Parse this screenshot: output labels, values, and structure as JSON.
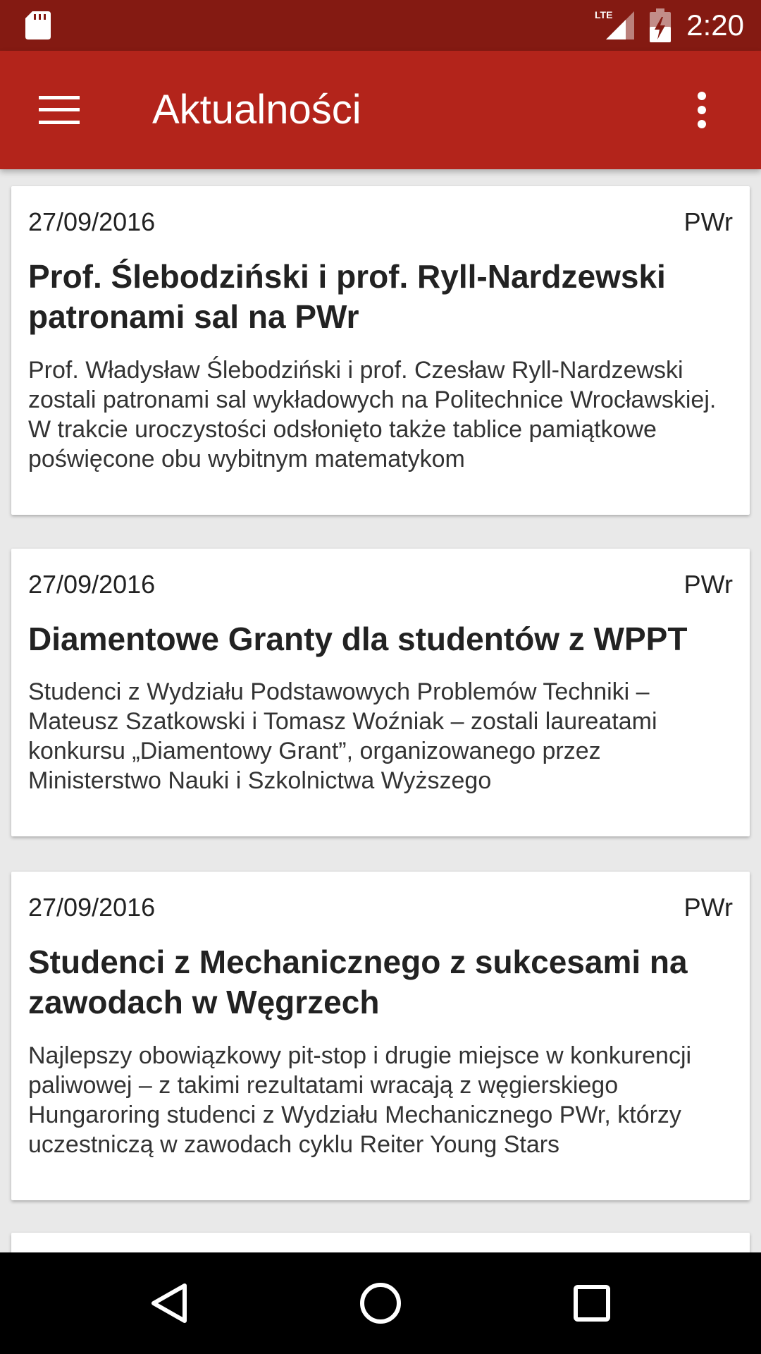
{
  "status_bar": {
    "time": "2:20",
    "network_label": "LTE",
    "icons": [
      "sd-card-icon",
      "lte-signal-icon",
      "battery-charging-icon"
    ]
  },
  "app_bar": {
    "title": "Aktualności",
    "icons": [
      "menu-icon",
      "more-vert-icon"
    ]
  },
  "articles": [
    {
      "date": "27/09/2016",
      "source": "PWr",
      "title": "Prof. Ślebodziński i prof. Ryll-Nardzewski patronami sal na PWr",
      "summary": "Prof. Władysław Ślebodziński i prof. Czesław Ryll-Nardzewski zostali patronami sal wykładowych na Politechnice Wrocławskiej. W trakcie uroczystości odsłonięto także tablice pamiątkowe poświęcone obu wybitnym matematykom"
    },
    {
      "date": "27/09/2016",
      "source": "PWr",
      "title": "Diamentowe Granty dla studentów z WPPT",
      "summary": "Studenci z Wydziału Podstawowych Problemów Techniki – Mateusz Szatkowski i Tomasz Woźniak – zostali laureatami konkursu „Diamentowy Grant”, organizowanego przez Ministerstwo Nauki i Szkolnictwa Wyższego"
    },
    {
      "date": "27/09/2016",
      "source": "PWr",
      "title": "Studenci z Mechanicznego z sukcesami na zawodach w Węgrzech",
      "summary": "Najlepszy obowiązkowy pit-stop i drugie miejsce w konkurencji paliwowej – z takimi rezultatami wracają z węgierskiego Hungaroring studenci z Wydziału Mechanicznego PWr, którzy uczestniczą w zawodach cyklu Reiter Young Stars"
    }
  ],
  "nav_bar": {
    "icons": [
      "back-icon",
      "home-icon",
      "recents-icon"
    ]
  },
  "colors": {
    "status_bar": "#841a12",
    "app_bar": "#b3241b",
    "background": "#e9e9e9",
    "card": "#ffffff",
    "text": "#222222"
  }
}
